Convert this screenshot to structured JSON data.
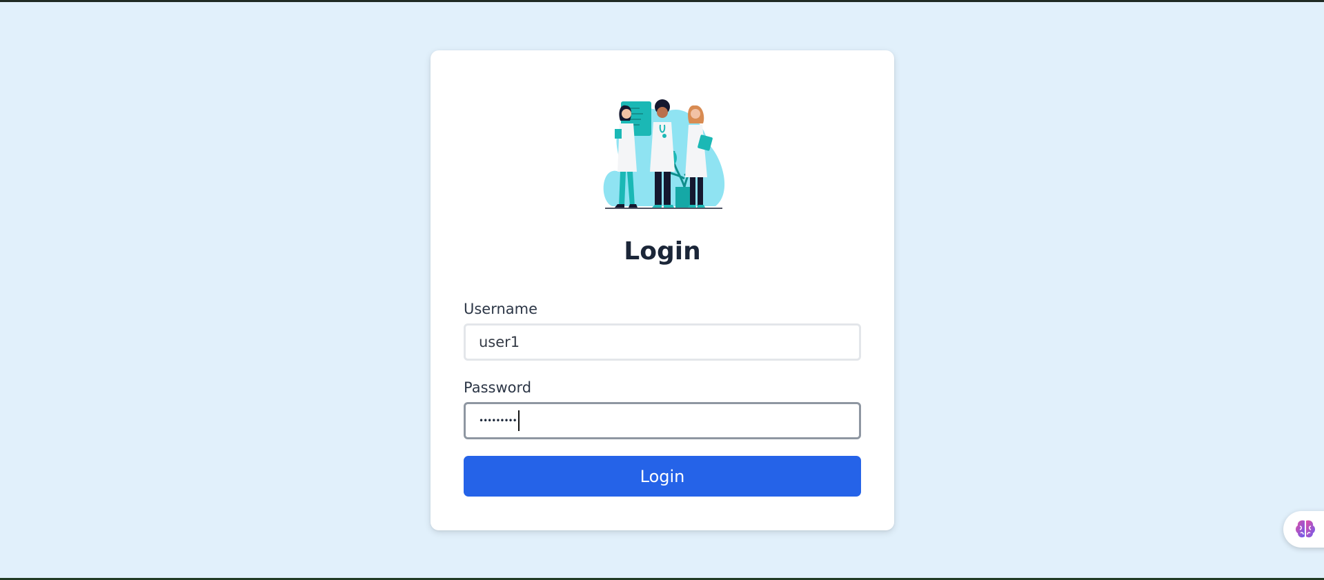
{
  "login": {
    "title": "Login",
    "username_label": "Username",
    "username_value": "user1",
    "password_label": "Password",
    "password_mask": "•••••••••",
    "submit_label": "Login"
  },
  "icons": {
    "illustration": "doctors-illustration",
    "assistant": "brain-icon"
  },
  "colors": {
    "page_background": "#e1f0fb",
    "card_background": "#ffffff",
    "primary_button": "#2563e8",
    "title_text": "#1b2638",
    "illustration_teal": "#1bb8b5",
    "illustration_blob": "#8fe3f2"
  }
}
